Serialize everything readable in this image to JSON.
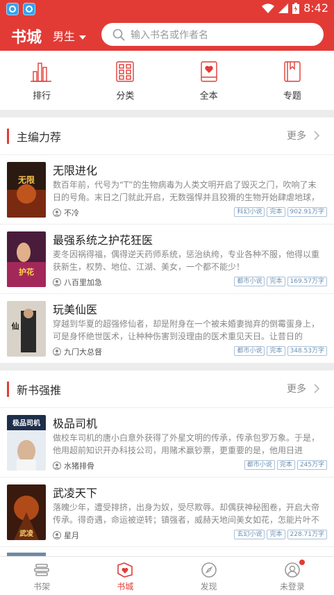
{
  "status": {
    "time": "8:42"
  },
  "header": {
    "title": "书城",
    "gender": "男生",
    "search_placeholder": "输入书名或作者名"
  },
  "quicknav": [
    {
      "label": "排行",
      "icon": "ranking-icon"
    },
    {
      "label": "分类",
      "icon": "category-icon"
    },
    {
      "label": "全本",
      "icon": "complete-book-icon"
    },
    {
      "label": "专题",
      "icon": "topic-icon"
    }
  ],
  "sections": [
    {
      "title": "主编力荐",
      "more": "更多",
      "books": [
        {
          "title": "无限进化",
          "desc": "数百年前，代号为“T”的生物病毒为人类文明开启了毁灭之门，吹响了末日的号角。末日之门就此开启，无数强悍并且狡猾的生物开始肆虐地球，人",
          "author": "不冷",
          "tags": [
            "科幻小说",
            "完本",
            "902.91万字"
          ]
        },
        {
          "title": "最强系统之护花狂医",
          "desc": "麦冬因祸得福，偶得逆天药师系统，惩治纨绔，专业各种不服，他得以重获新生，权势、地位、江湖、美女，一个都不能少！",
          "author": "八百里加急",
          "tags": [
            "都市小说",
            "完本",
            "169.57万字"
          ]
        },
        {
          "title": "玩美仙医",
          "desc": "穿越到华夏的超强修仙者，却是附身在一个被未婚妻抛弃的倒霉蛋身上，可是身怀绝世医术，让种种伤害到没理由的医术重见天日。让昔日的",
          "author": "九门大总督",
          "tags": [
            "都市小说",
            "完本",
            "348.53万字"
          ]
        }
      ]
    },
    {
      "title": "新书强推",
      "more": "更多",
      "books": [
        {
          "title": "极品司机",
          "desc": "做校车司机的唐小白意外获得了外星文明的传承，传承包罗万象。于是，他用超前知识开办科技公司，用赌术赢钞票，更重要的是，他用日进",
          "author": "水猪排骨",
          "tags": [
            "都市小说",
            "完本",
            "245万字"
          ]
        },
        {
          "title": "武凌天下",
          "desc": "落魄少年，遭受排挤，出身为奴，受尽欺辱。却偶获神秘图卷，开启大帝传承。得奇遇，命运被逆转；镇强者，威赫天地间美女如花，怎能片叶不",
          "author": "星月",
          "tags": [
            "玄幻小说",
            "完本",
            "228.71万字"
          ]
        }
      ]
    }
  ],
  "bottomnav": [
    {
      "label": "书架",
      "icon": "bookshelf-icon"
    },
    {
      "label": "书城",
      "icon": "bookstore-icon",
      "active": true
    },
    {
      "label": "发现",
      "icon": "compass-icon"
    },
    {
      "label": "未登录",
      "icon": "user-icon"
    }
  ]
}
